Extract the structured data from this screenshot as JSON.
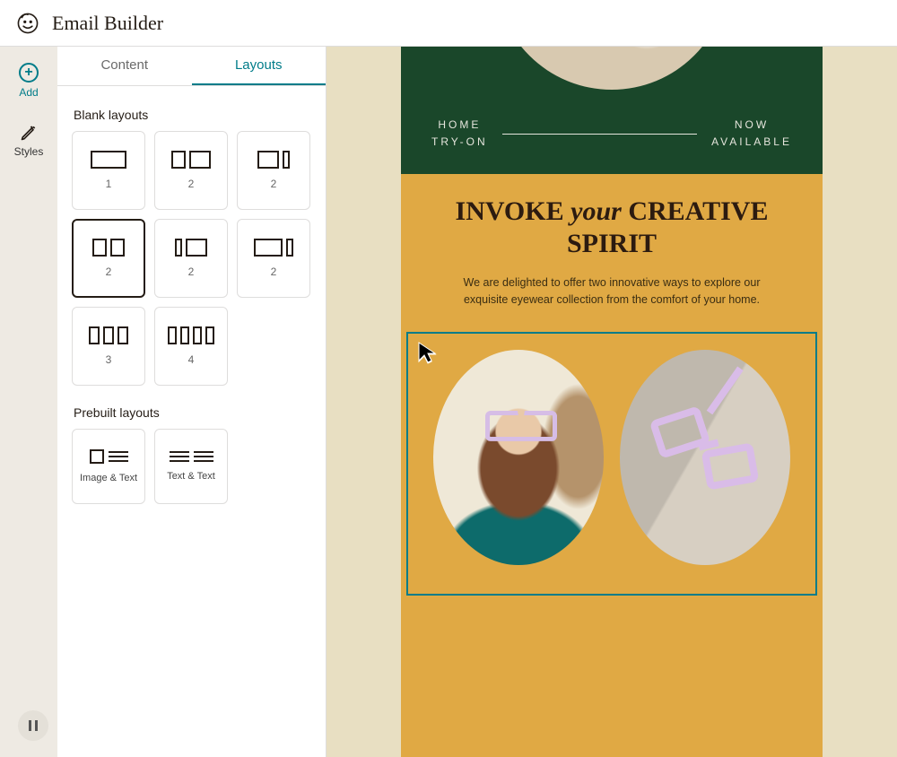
{
  "header": {
    "title": "Email Builder"
  },
  "rail": {
    "add_label": "Add",
    "styles_label": "Styles"
  },
  "tabs": {
    "content": "Content",
    "layouts": "Layouts",
    "active": "layouts"
  },
  "sections": {
    "blank_title": "Blank layouts",
    "prebuilt_title": "Prebuilt layouts"
  },
  "layouts": [
    {
      "id": "1col",
      "count": "1",
      "selected": false
    },
    {
      "id": "2col-a",
      "count": "2",
      "selected": false
    },
    {
      "id": "2col-b",
      "count": "2",
      "selected": false
    },
    {
      "id": "2col-c",
      "count": "2",
      "selected": true
    },
    {
      "id": "2col-d",
      "count": "2",
      "selected": false
    },
    {
      "id": "2col-e",
      "count": "2",
      "selected": false
    },
    {
      "id": "3col",
      "count": "3",
      "selected": false
    },
    {
      "id": "4col",
      "count": "4",
      "selected": false
    }
  ],
  "prebuilt": [
    {
      "id": "image-text",
      "label": "Image & Text"
    },
    {
      "id": "text-text",
      "label": "Text & Text"
    }
  ],
  "email": {
    "nav_left": "HOME\nTRY-ON",
    "nav_right": "NOW\nAVAILABLE",
    "headline_pre": "INVOKE ",
    "headline_em": "your",
    "headline_post": " CREATIVE SPIRIT",
    "subcopy": "We are delighted to offer two innovative ways to explore our exquisite eyewear collection from the comfort of your home."
  },
  "controls": {
    "pause_label": "Pause"
  }
}
